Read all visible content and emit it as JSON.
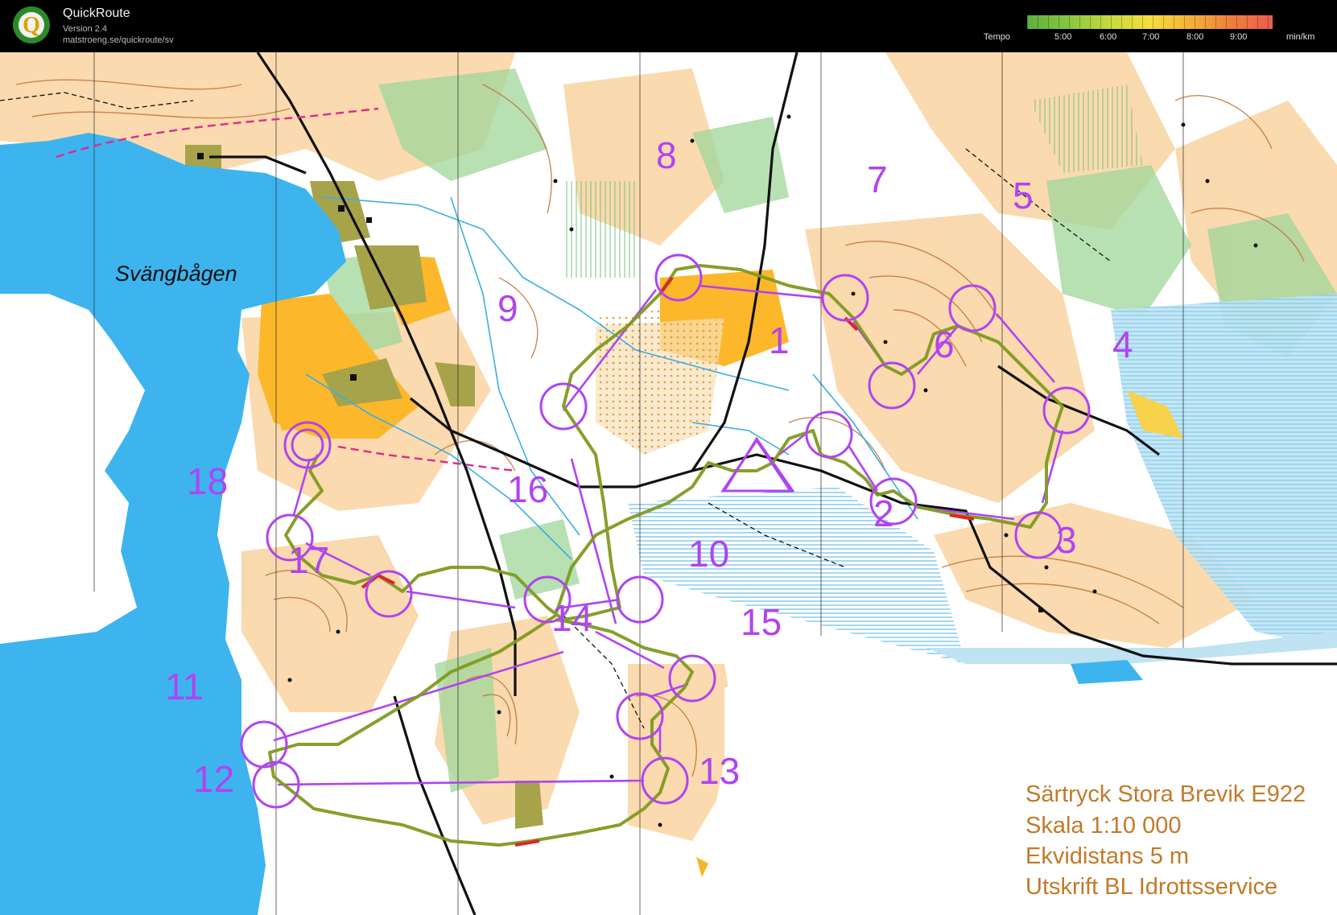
{
  "app": {
    "title": "QuickRoute",
    "version": "Version 2.4",
    "url": "matstroeng.se/quickroute/sv"
  },
  "tempo": {
    "label": "Tempo",
    "ticks": [
      "5:00",
      "6:00",
      "7:00",
      "8:00",
      "9:00"
    ],
    "unit": "min/km"
  },
  "map": {
    "lake_name": "Svängbågen",
    "legend": [
      "Särtryck Stora Brevik E922",
      "Skala 1:10 000",
      "Ekvidistans 5 m",
      "Utskrift BL Idrottsservice"
    ],
    "controls": [
      "1",
      "2",
      "3",
      "4",
      "5",
      "6",
      "7",
      "8",
      "9",
      "10",
      "11",
      "12",
      "13",
      "14",
      "15",
      "16",
      "17",
      "18"
    ]
  },
  "colors": {
    "water": "#3db4ee",
    "open_land": "#f7c98b",
    "rough_open": "#fbe3bf",
    "field": "#fdb72a",
    "green": "#8fd08a",
    "marsh": "#67c2e8",
    "course": "#b044f0",
    "route": "#8a9a28",
    "contour": "#b8642a"
  }
}
